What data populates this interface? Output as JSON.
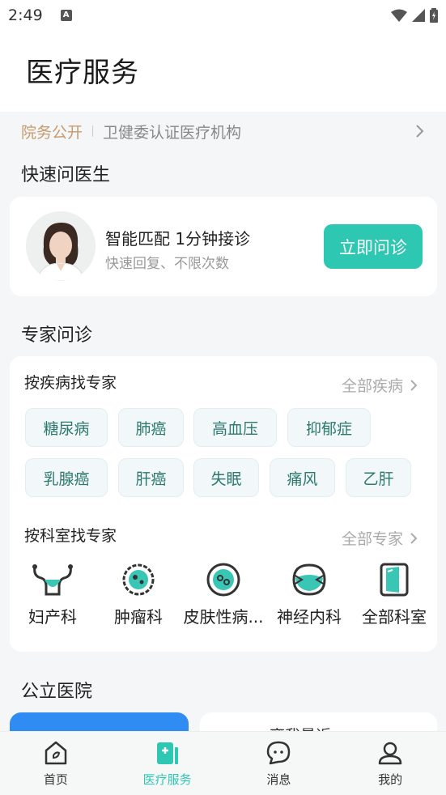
{
  "status_bar": {
    "time": "2:49",
    "notification_icon": "A"
  },
  "header": {
    "title": "医疗服务"
  },
  "notice": {
    "tag": "院务公开",
    "text": "卫健委认证医疗机构"
  },
  "quick": {
    "section_title": "快速问医生",
    "title": "智能匹配 1分钟接诊",
    "subtitle": "快速回复、不限次数",
    "button": "立即问诊"
  },
  "expert": {
    "section_title": "专家问诊",
    "disease": {
      "title": "按疾病找专家",
      "all": "全部疾病",
      "tags": [
        "糖尿病",
        "肺癌",
        "高血压",
        "抑郁症",
        "乳腺癌",
        "肝癌",
        "失眠",
        "痛风",
        "乙肝"
      ]
    },
    "dept": {
      "title": "按科室找专家",
      "all": "全部专家",
      "items": [
        {
          "label": "妇产科",
          "icon": "uterus-icon"
        },
        {
          "label": "肿瘤科",
          "icon": "tumor-icon"
        },
        {
          "label": "皮肤性病...",
          "icon": "skin-icon"
        },
        {
          "label": "神经内科",
          "icon": "neuro-icon"
        },
        {
          "label": "全部科室",
          "icon": "door-icon"
        }
      ]
    }
  },
  "hospital": {
    "section_title": "公立医院",
    "nearby": "离我最近"
  },
  "tabs": [
    {
      "label": "首页",
      "icon": "home-icon",
      "active": false
    },
    {
      "label": "医疗服务",
      "icon": "medical-icon",
      "active": true
    },
    {
      "label": "消息",
      "icon": "message-icon",
      "active": false
    },
    {
      "label": "我的",
      "icon": "profile-icon",
      "active": false
    }
  ],
  "colors": {
    "accent": "#2ec7b2",
    "notice_tag": "#c69a6d",
    "hospital_blue": "#2f8cf2"
  }
}
